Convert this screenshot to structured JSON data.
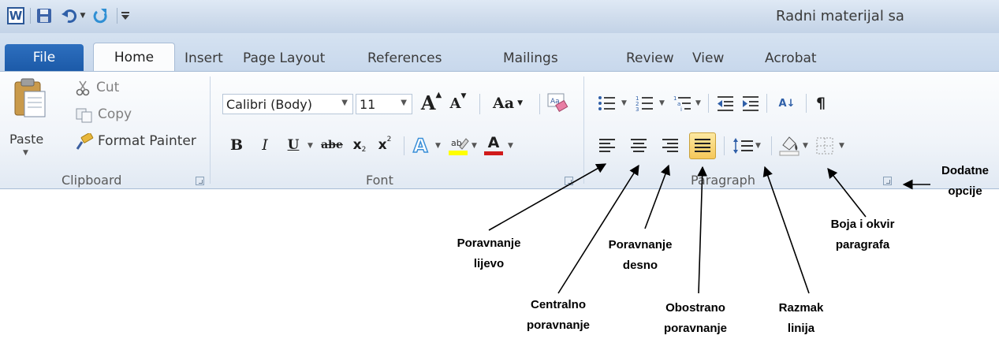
{
  "title_bar": {
    "app_icon": "W",
    "quick_access": [
      "save-icon",
      "undo-icon",
      "dropdown-icon",
      "redo-icon",
      "customize-icon"
    ],
    "document_title": "Radni materijal sa"
  },
  "tabs": {
    "file": "File",
    "home": "Home",
    "insert": "Insert",
    "page_layout": "Page Layout",
    "references": "References",
    "mailings": "Mailings",
    "review": "Review",
    "view": "View",
    "acrobat": "Acrobat"
  },
  "clipboard": {
    "paste": "Paste",
    "cut": "Cut",
    "copy": "Copy",
    "format_painter": "Format Painter",
    "label": "Clipboard"
  },
  "font": {
    "font_name": "Calibri (Body)",
    "font_size": "11",
    "grow": "A",
    "shrink": "A",
    "change_case": "Aa",
    "bold": "B",
    "italic": "I",
    "underline": "U",
    "strike": "abe",
    "subscript": "x",
    "superscript": "x",
    "font_color": "A",
    "label": "Font",
    "highlight_color": "#ffff00",
    "font_color_value": "#d01b1b"
  },
  "paragraph": {
    "label": "Paragraph",
    "pilcrow": "¶",
    "sort": "A↓"
  },
  "annotations": {
    "dodatne": [
      "Dodatne",
      "opcije"
    ],
    "poravnanje_lijevo": [
      "Poravnanje",
      "lijevo"
    ],
    "poravnanje_desno": [
      "Poravnanje",
      "desno"
    ],
    "boja_okvir": [
      "Boja i okvir",
      "paragrafa"
    ],
    "centralno": [
      "Centralno",
      "poravnanje"
    ],
    "obostrano": [
      "Obostrano",
      "poravnanje"
    ],
    "razmak": [
      "Razmak",
      "linija"
    ]
  }
}
